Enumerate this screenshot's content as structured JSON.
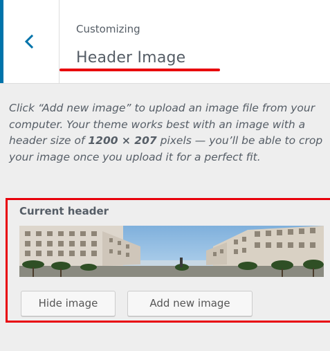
{
  "header": {
    "customizing_label": "Customizing",
    "section_title": "Header Image",
    "accent_color": "#0073aa",
    "back_icon": "chevron-left-icon"
  },
  "description": {
    "before": "Click “Add new image” to upload an image file from your computer. Your theme works best with an image with a header size of ",
    "size": "1200 × 207",
    "after": " pixels — you’ll be able to crop your image once you upload it for a perfect fit."
  },
  "current_header": {
    "label": "Current header",
    "image_subject": "city-square-photo"
  },
  "buttons": {
    "hide_label": "Hide image",
    "add_label": "Add new image"
  },
  "annotation_color": "#e8000b"
}
